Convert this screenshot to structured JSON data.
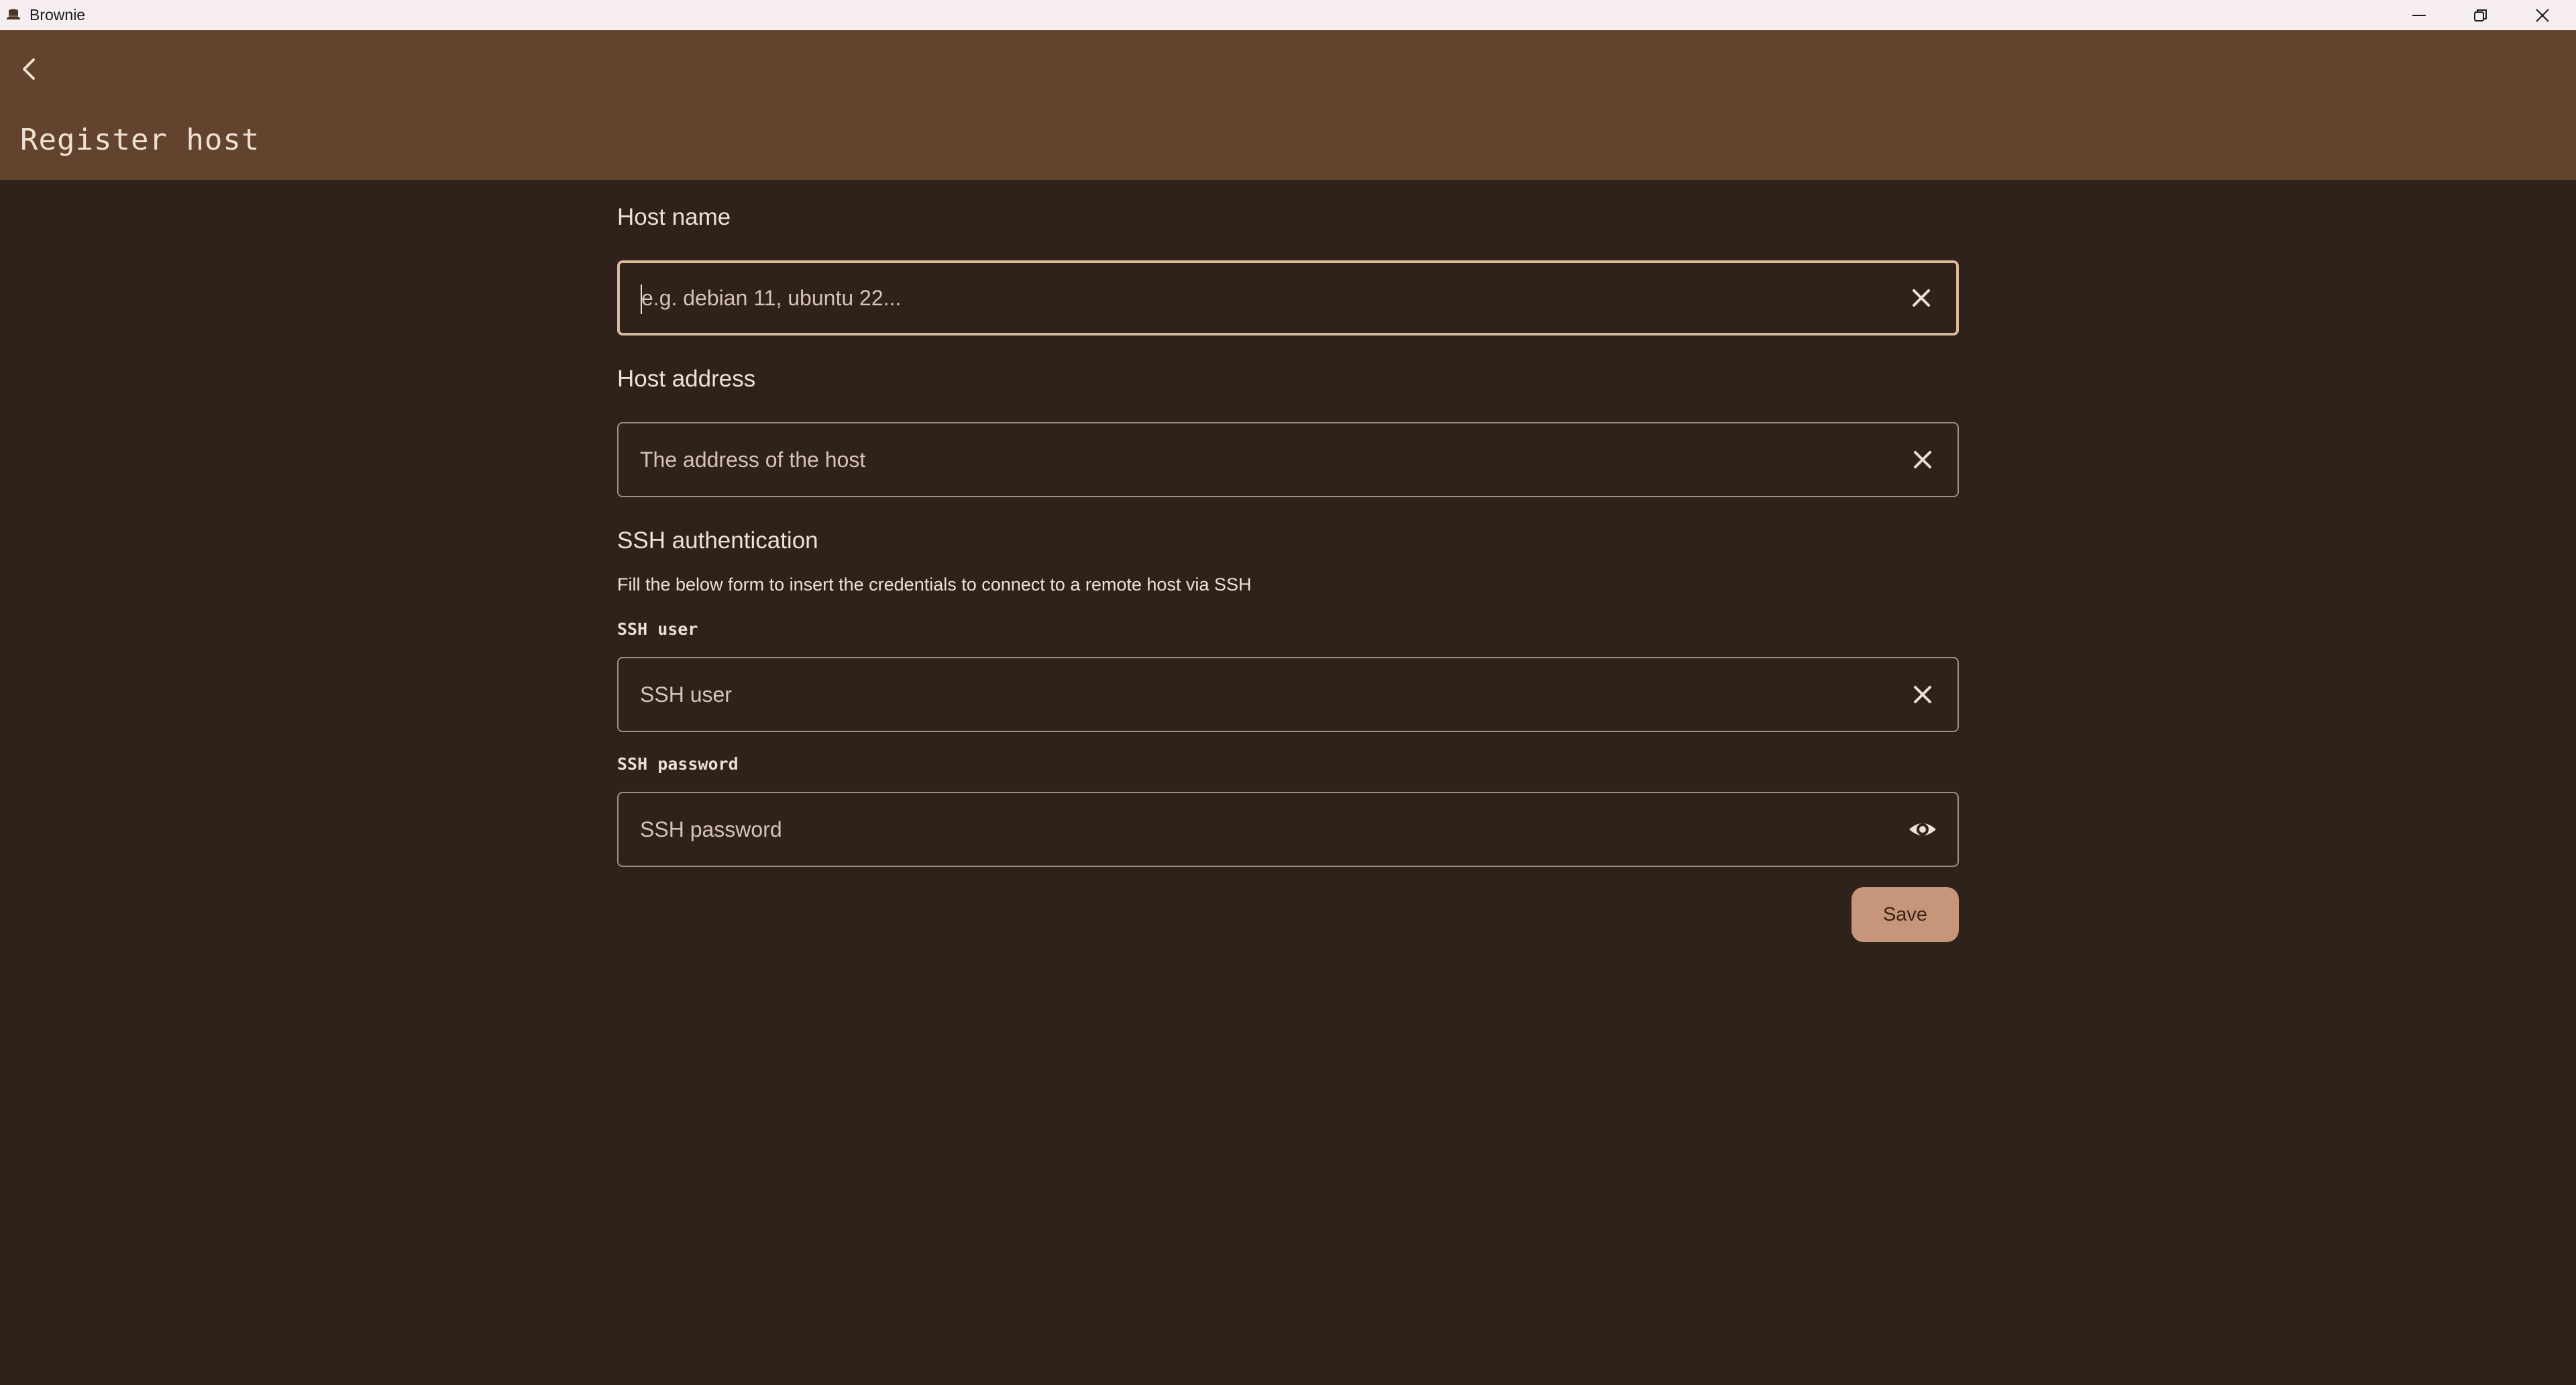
{
  "window": {
    "title": "Brownie",
    "app_icon": "brownie-hat-icon",
    "controls": [
      "minimize-icon",
      "restore-icon",
      "close-icon"
    ]
  },
  "appbar": {
    "back_icon": "chevron-left-icon",
    "title": "Register host"
  },
  "form": {
    "host_name": {
      "label": "Host name",
      "placeholder": "e.g. debian 11, ubuntu 22...",
      "value": "",
      "icon": "clear-icon"
    },
    "host_address": {
      "label": "Host address",
      "placeholder": "The address of the host",
      "value": "",
      "icon": "clear-icon"
    },
    "ssh": {
      "heading": "SSH authentication",
      "hint": "Fill the below form to insert the credentials to connect to a remote host via SSH",
      "user": {
        "label": "SSH user",
        "placeholder": "SSH user",
        "value": "",
        "icon": "clear-icon"
      },
      "password": {
        "label": "SSH password",
        "placeholder": "SSH password",
        "value": "",
        "icon": "eye-icon"
      }
    },
    "save_label": "Save"
  },
  "colors": {
    "titlebar_bg": "#f6eef1",
    "appbar_bg": "#62432d",
    "page_bg": "#2e221b",
    "text": "#efe0d4",
    "field_border": "#a18d80",
    "focused_border": "#d9b99b",
    "button_bg": "#c7967a"
  }
}
